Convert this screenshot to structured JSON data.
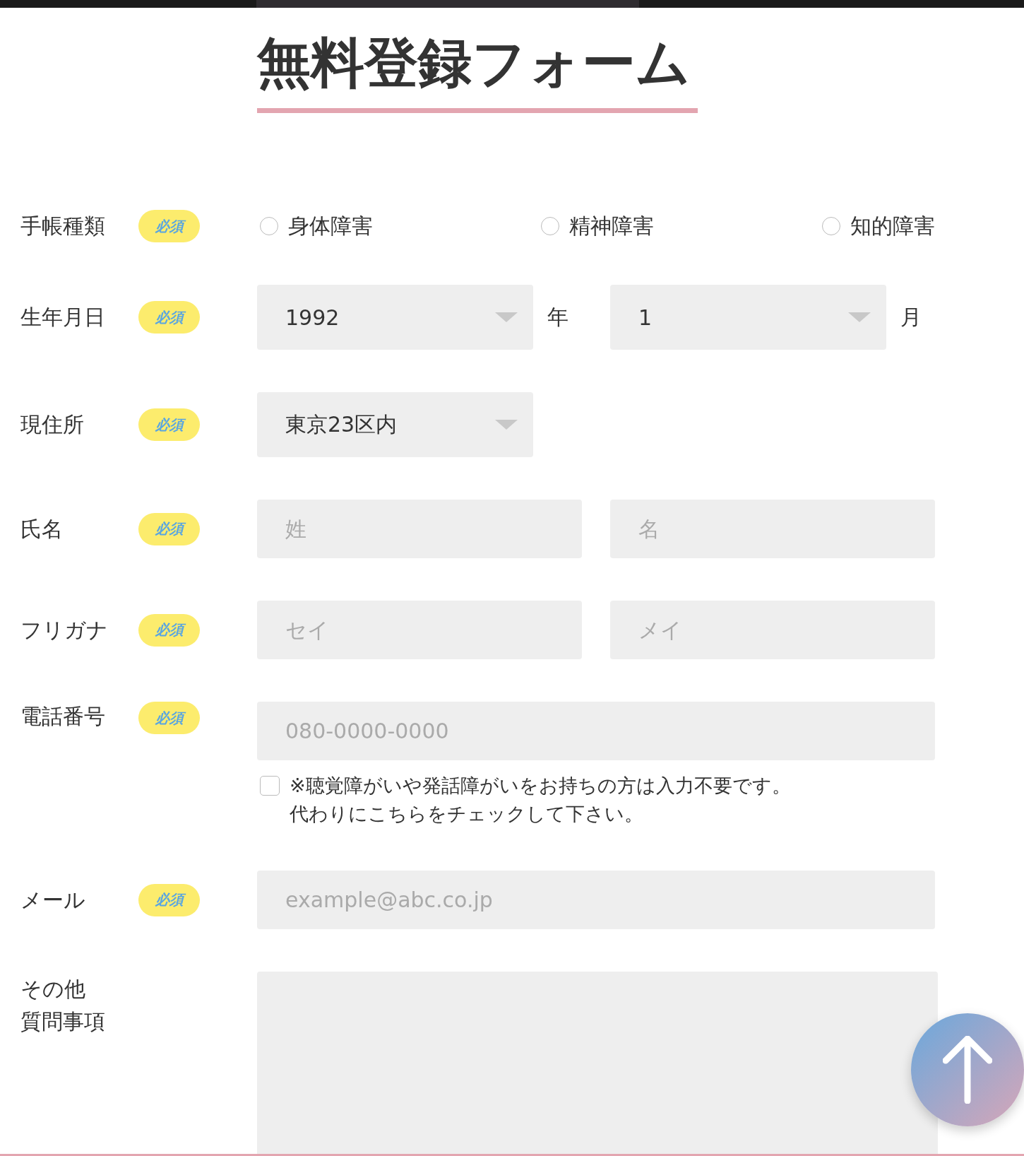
{
  "title": "無料登録フォーム",
  "fields": [
    {
      "kind": "radio",
      "label": "手帳種類",
      "badge": "必須",
      "options": [
        {
          "label": "身体障害",
          "selected": false
        },
        {
          "label": "精神障害",
          "selected": false
        },
        {
          "label": "知的障害",
          "selected": false
        }
      ]
    },
    {
      "kind": "date",
      "label": "生年月日",
      "badge": "必須",
      "selects": [
        {
          "value": "1992",
          "unit": "年"
        },
        {
          "value": "1",
          "unit": "月"
        }
      ]
    },
    {
      "kind": "select",
      "label": "現住所",
      "badge": "必須",
      "value": "東京23区内"
    },
    {
      "kind": "pair",
      "label": "氏名",
      "badge": "必須",
      "placeholders": [
        "姓",
        "名"
      ]
    },
    {
      "kind": "pair",
      "label": "フリガナ",
      "badge": "必須",
      "placeholders": [
        "セイ",
        "メイ"
      ]
    },
    {
      "kind": "phone",
      "label": "電話番号",
      "badge": "必須",
      "placeholder": "080-0000-0000",
      "note": {
        "checked": false,
        "lines": [
          "※聴覚障がいや発話障がいをお持ちの方は入力不要です。",
          "代わりにこちらをチェックして下さい。"
        ]
      }
    },
    {
      "kind": "text",
      "label": "メール",
      "badge": "必須",
      "placeholder": "example@abc.co.jp"
    },
    {
      "kind": "textarea",
      "label_lines": [
        "その他",
        "質問事項"
      ]
    }
  ]
}
